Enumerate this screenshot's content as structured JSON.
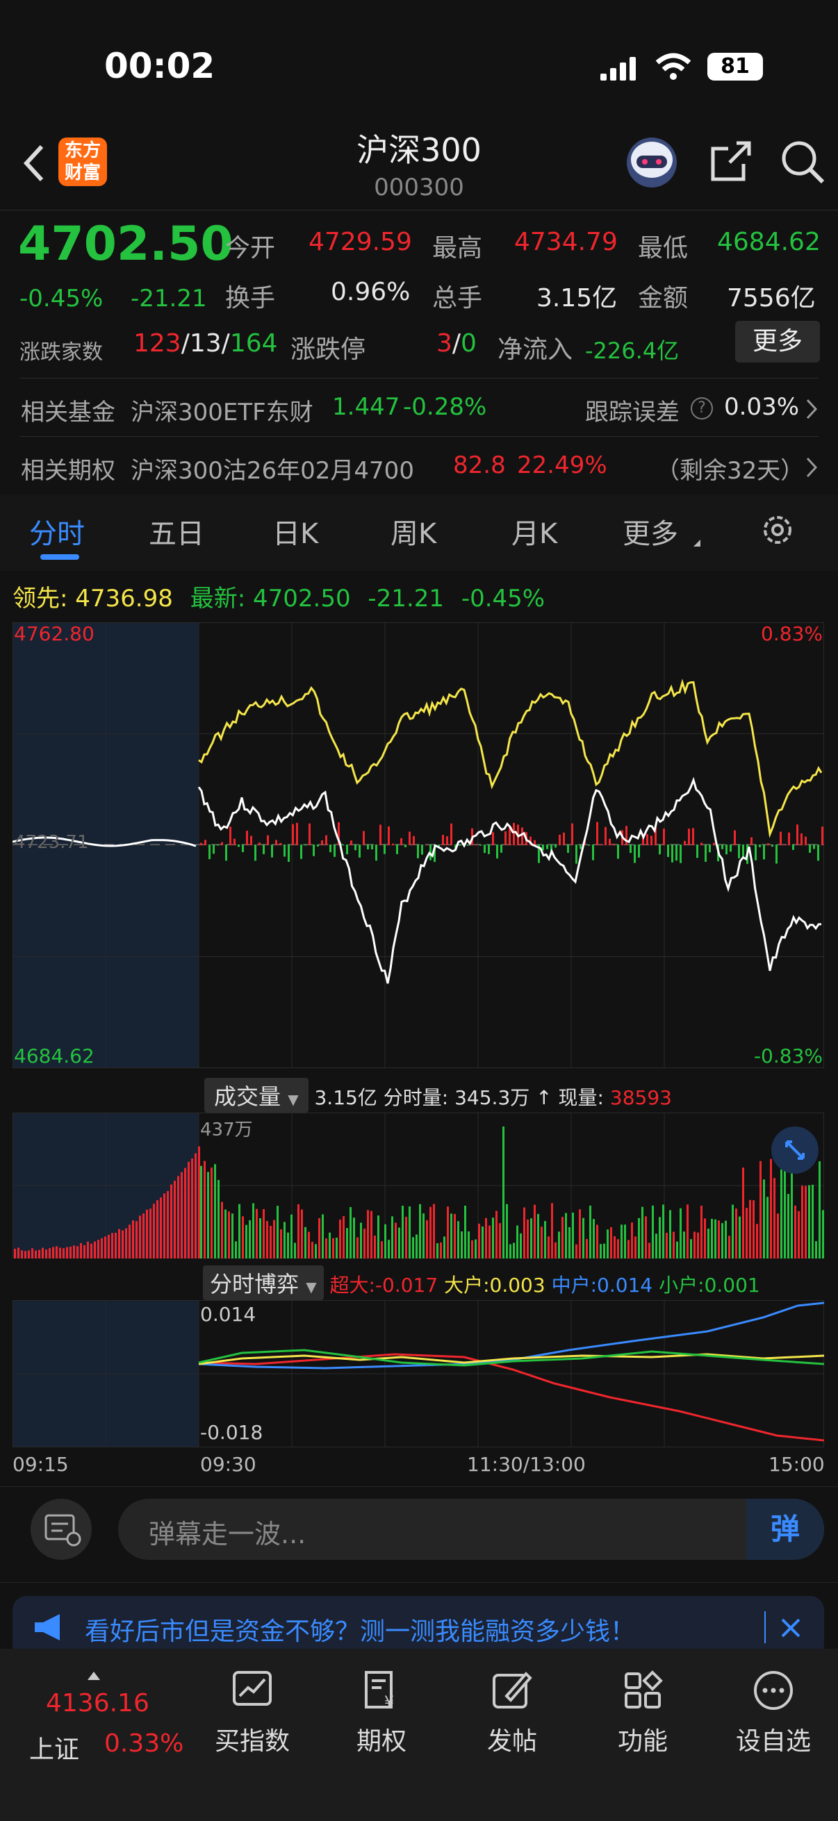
{
  "status_bar": {
    "time": "00:02",
    "battery": "81"
  },
  "header": {
    "logo_text": "东方\n财富",
    "title": "沪深300",
    "code": "000300"
  },
  "quote": {
    "price": "4702.50",
    "change_pct": "-0.45%",
    "change": "-21.21",
    "open_label": "今开",
    "open": "4729.59",
    "high_label": "最高",
    "high": "4734.79",
    "low_label": "最低",
    "low": "4684.62",
    "turnover_label": "换手",
    "turnover": "0.96%",
    "volume_label": "总手",
    "volume": "3.15亿",
    "amount_label": "金额",
    "amount": "7556亿",
    "breadth_label": "涨跌家数",
    "up": "123",
    "flat": "13",
    "down": "164",
    "limit_label": "涨跌停",
    "limit_up": "3",
    "limit_down": "0",
    "netflow_label": "净流入",
    "netflow": "-226.4亿",
    "more_button": "更多"
  },
  "fund": {
    "label": "相关基金",
    "name": "沪深300ETF东财",
    "price": "1.447",
    "pct": "-0.28%",
    "track_label": "跟踪误差",
    "track_value": "0.03%"
  },
  "option": {
    "label": "相关期权",
    "name": "沪深300沽26年02月4700",
    "price": "82.8",
    "pct": "22.49%",
    "remain": "（剩余32天）"
  },
  "tabs": [
    "分时",
    "五日",
    "日K",
    "周K",
    "月K",
    "更多"
  ],
  "legend": {
    "lead_label": "领先:",
    "lead": "4736.98",
    "latest_label": "最新:",
    "latest": "4702.50",
    "chg": "-21.21",
    "pct": "-0.45%"
  },
  "price_chart": {
    "y_max": "4762.80",
    "y_min": "4684.62",
    "pct_max": "0.83%",
    "pct_min": "-0.83%",
    "prev_close": "4723.71"
  },
  "volume_bar": {
    "selector": "成交量",
    "total": "3.15亿",
    "tick_label": "分时量:",
    "tick": "345.3万",
    "arrow": "↑",
    "now_label": "现量:",
    "now": "38593",
    "max_label": "437万"
  },
  "game_bar": {
    "selector": "分时博弈",
    "super_label": "超大:",
    "super": "-0.017",
    "large_label": "大户:",
    "large": "0.003",
    "mid_label": "中户:",
    "mid": "0.014",
    "small_label": "小户:",
    "small": "0.001",
    "top": "0.014",
    "bottom": "-0.018"
  },
  "time_axis": [
    "09:15",
    "09:30",
    "11:30/13:00",
    "15:00"
  ],
  "danmu": {
    "placeholder": "弹幕走一波...",
    "send": "弹"
  },
  "ad": {
    "text": "看好后市但是资金不够？测一测我能融资多少钱！"
  },
  "bottom_nav": {
    "index_value": "4136.16",
    "index_name": "上证",
    "index_pct": "0.33%",
    "items": [
      "买指数",
      "期权",
      "发帖",
      "功能",
      "设自选"
    ]
  },
  "colors": {
    "red": "#f0262d",
    "green": "#24c23f",
    "yellow": "#f5e64a",
    "blue": "#3a8bff"
  }
}
